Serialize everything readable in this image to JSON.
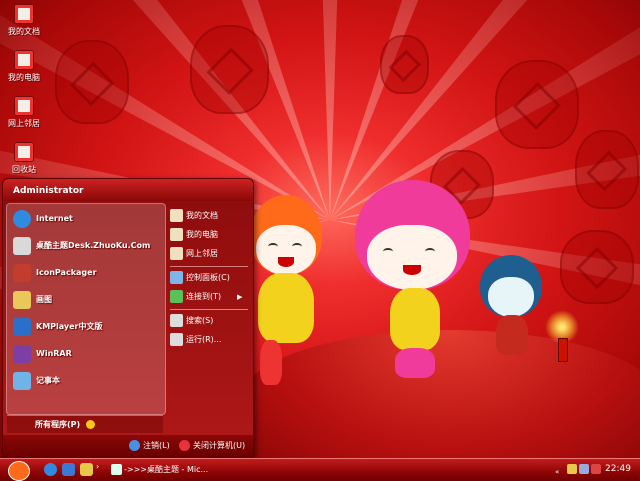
{
  "desktop_icons": [
    {
      "label": "我的文档",
      "icon": "my-documents-icon"
    },
    {
      "label": "我的电脑",
      "icon": "my-computer-icon"
    },
    {
      "label": "网上邻居",
      "icon": "network-places-icon"
    },
    {
      "label": "回收站",
      "icon": "recycle-bin-icon"
    }
  ],
  "start_menu": {
    "user": "Administrator",
    "pinned": [
      {
        "label": "Internet",
        "icon": "internet-explorer-icon",
        "color": "#2f8ae0"
      },
      {
        "label": "桌酷主题Desk.ZhuoKu.Com",
        "icon": "zhuoku-theme-icon",
        "color": "#d9d9d9"
      },
      {
        "label": "IconPackager",
        "icon": "iconpackager-icon",
        "color": "#c43c2c"
      },
      {
        "label": "画图",
        "icon": "paint-icon",
        "color": "#e9c75a"
      },
      {
        "label": "KMPlayer中文版",
        "icon": "kmplayer-icon",
        "color": "#2a6fc8"
      },
      {
        "label": "WinRAR",
        "icon": "winrar-icon",
        "color": "#7d3fa6"
      },
      {
        "label": "记事本",
        "icon": "notepad-icon",
        "color": "#6fb3e8"
      }
    ],
    "right": [
      {
        "label": "我的文档",
        "icon": "my-documents-icon",
        "color": "#f0e0c0"
      },
      {
        "label": "我的电脑",
        "icon": "my-computer-icon",
        "color": "#f0e0c0"
      },
      {
        "label": "网上邻居",
        "icon": "network-places-icon",
        "color": "#f0e0c0"
      },
      {
        "label": "控制面板(C)",
        "icon": "control-panel-icon",
        "color": "#7db5e8"
      },
      {
        "label": "连接到(T)",
        "icon": "connect-to-icon",
        "color": "#59c05a"
      },
      {
        "label": "搜索(S)",
        "icon": "search-icon",
        "color": "#ddd"
      },
      {
        "label": "运行(R)...",
        "icon": "run-icon",
        "color": "#ddd"
      }
    ],
    "all_programs": "所有程序(P)",
    "logoff": "注销(L)",
    "shutdown": "关闭计算机(U)"
  },
  "taskbar": {
    "task": "->>>桌酷主题 - Mic...",
    "clock": "22:49"
  },
  "colors": {
    "accent": "#d21414",
    "taskbar": "#8f0505"
  }
}
